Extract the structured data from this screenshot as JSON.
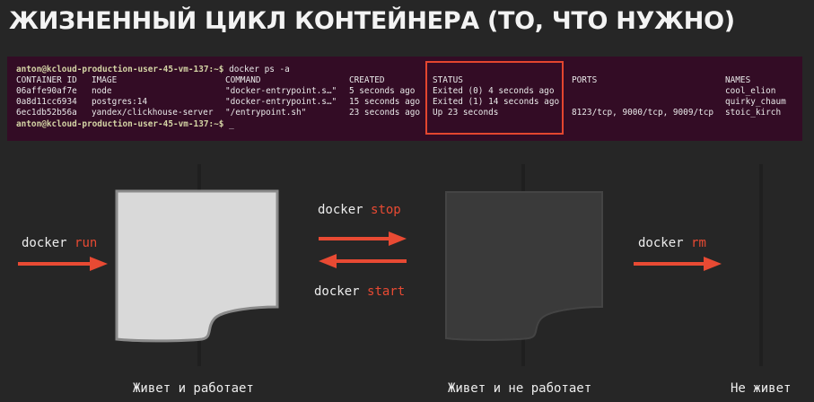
{
  "slide": {
    "title": "ЖИЗНЕННЫЙ ЦИКЛ КОНТЕЙНЕРА (ТО, ЧТО НУЖНО)"
  },
  "terminal": {
    "prompt": "anton@kcloud-production-user-45-vm-137:~$",
    "command": " docker ps -a",
    "cursor": " _",
    "headers": {
      "container_id": "CONTAINER ID",
      "image": "IMAGE",
      "command": "COMMAND",
      "created": "CREATED",
      "status": "STATUS",
      "ports": "PORTS",
      "names": "NAMES"
    },
    "rows": [
      {
        "container_id": "06affe90af7e",
        "image": "node",
        "command": "\"docker-entrypoint.s…\"",
        "created": "5 seconds ago",
        "status": "Exited (0) 4 seconds ago",
        "ports": "",
        "names": "cool_elion"
      },
      {
        "container_id": "0a8d11cc6934",
        "image": "postgres:14",
        "command": "\"docker-entrypoint.s…\"",
        "created": "15 seconds ago",
        "status": "Exited (1) 14 seconds ago",
        "ports": "",
        "names": "quirky_chaum"
      },
      {
        "container_id": "6ec1db52b56a",
        "image": "yandex/clickhouse-server",
        "command": "\"/entrypoint.sh\"",
        "created": "23 seconds ago",
        "status": "Up 23 seconds",
        "ports": "8123/tcp, 9000/tcp, 9009/tcp",
        "names": "stoic_kirch"
      }
    ]
  },
  "diagram": {
    "docker_word": "docker",
    "run": "run",
    "stop": "stop",
    "start": "start",
    "rm": "rm",
    "captions": {
      "running": "Живет и работает",
      "stopped": "Живет и не работает",
      "removed": "Не живет"
    }
  },
  "colors": {
    "background": "#262626",
    "accent": "#e84a33",
    "terminal_bg": "#330c25",
    "doc_running": "#d9d9d9",
    "doc_stopped": "#3a3a3a"
  }
}
